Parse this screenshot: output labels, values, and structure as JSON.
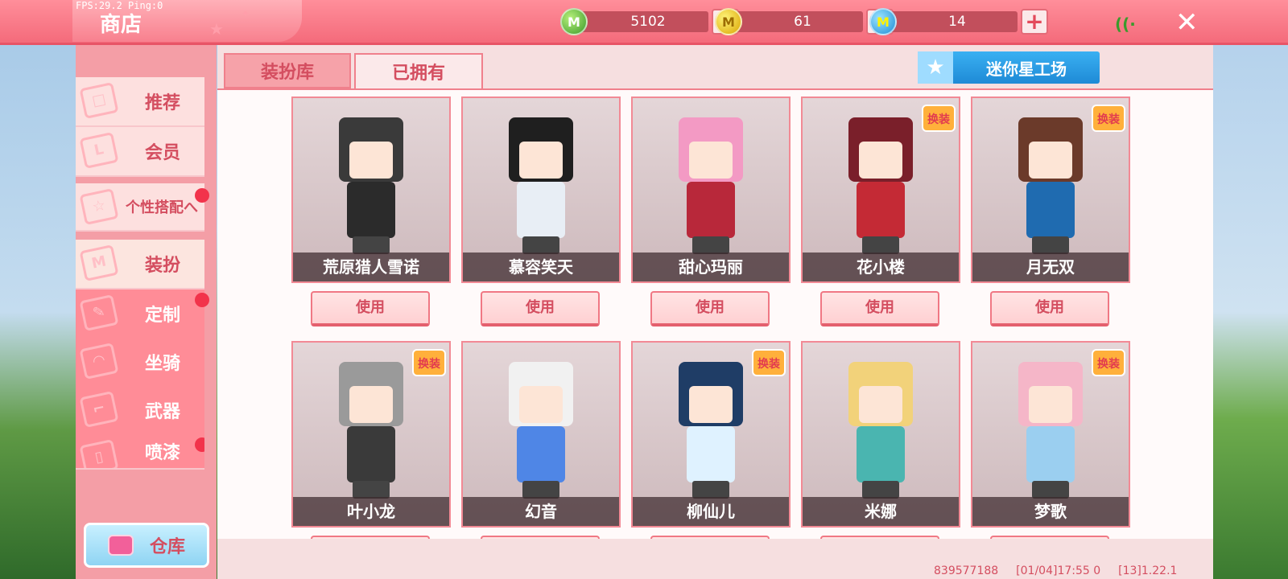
{
  "debug": {
    "fps_text": "FPS:29.2  Ping:0"
  },
  "header": {
    "title": "商店",
    "currencies": [
      {
        "icon": "green-gem-coin-icon",
        "symbol": "M",
        "value": "5102"
      },
      {
        "icon": "gold-coin-icon",
        "symbol": "M",
        "value": "61"
      },
      {
        "icon": "blue-coin-icon",
        "symbol": "M",
        "value": "14"
      }
    ],
    "plus": "+",
    "close": "✕",
    "signal": "((·"
  },
  "sidebar": {
    "items": [
      {
        "label": "推荐"
      },
      {
        "label": "会员"
      },
      {
        "label": "个性搭配へ"
      },
      {
        "label": "装扮"
      },
      {
        "label": "定制"
      },
      {
        "label": "坐骑"
      },
      {
        "label": "武器"
      },
      {
        "label": "喷漆"
      }
    ],
    "storage_label": "仓库"
  },
  "tabs": [
    {
      "label": "装扮库"
    },
    {
      "label": "已拥有"
    }
  ],
  "workshop_label": "迷你星工场",
  "use_label": "使用",
  "badge_text": "换装",
  "skins": [
    {
      "name": "荒原猎人雪诺",
      "hair": "#3a3a3a",
      "body": "#2b2b2b",
      "badge": false
    },
    {
      "name": "慕容笑天",
      "hair": "#1f1f1f",
      "body": "#e8eef5",
      "badge": false
    },
    {
      "name": "甜心玛丽",
      "hair": "#f39ac4",
      "body": "#b8283a",
      "badge": false
    },
    {
      "name": "花小楼",
      "hair": "#7a1f2a",
      "body": "#c42a35",
      "badge": true
    },
    {
      "name": "月无双",
      "hair": "#6b3a2a",
      "body": "#1f6bb0",
      "badge": true
    },
    {
      "name": "叶小龙",
      "hair": "#9a9a9a",
      "body": "#3a3a3a",
      "badge": true
    },
    {
      "name": "幻音",
      "hair": "#f1f1f1",
      "body": "#4f86e6",
      "badge": false
    },
    {
      "name": "柳仙儿",
      "hair": "#1f3d66",
      "body": "#dff2ff",
      "badge": true
    },
    {
      "name": "米娜",
      "hair": "#f2d27a",
      "body": "#4ab5b0",
      "badge": false
    },
    {
      "name": "梦歌",
      "hair": "#f5b6c8",
      "body": "#9bcff0",
      "badge": true
    }
  ],
  "footer": {
    "uid": "839577188",
    "time": "[01/04]17:55 0",
    "version": "[13]1.22.1"
  }
}
